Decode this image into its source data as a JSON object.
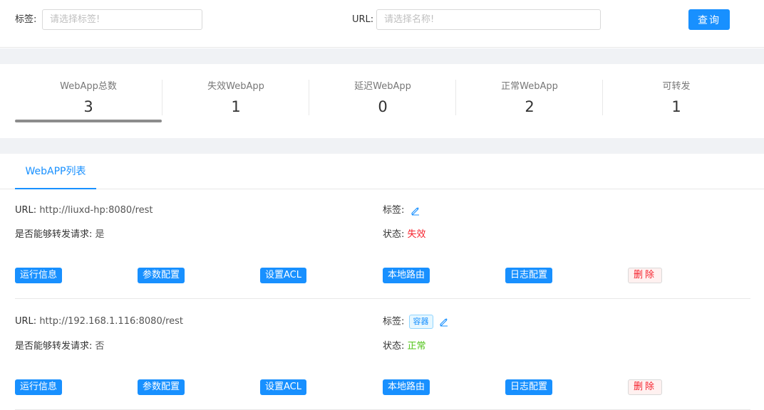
{
  "search": {
    "tag_label": "标签:",
    "tag_placeholder": "请选择标签!",
    "url_label": "URL:",
    "url_placeholder": "请选择名称!",
    "query_button": "查询"
  },
  "stats": [
    {
      "label": "WebApp总数",
      "value": "3"
    },
    {
      "label": "失效WebApp",
      "value": "1"
    },
    {
      "label": "延迟WebApp",
      "value": "0"
    },
    {
      "label": "正常WebApp",
      "value": "2"
    },
    {
      "label": "可转发",
      "value": "1"
    }
  ],
  "tabs": {
    "active": "WebAPP列表"
  },
  "webapps": [
    {
      "url_label": "URL:",
      "url": "http://liuxd-hp:8080/rest",
      "forward_label": "是否能够转发请求:",
      "forward": "是",
      "tag_label": "标签:",
      "tags": [],
      "status_label": "状态:",
      "status": "失效",
      "actions": [
        "运行信息",
        "参数配置",
        "设置ACL",
        "本地路由",
        "日志配置"
      ],
      "delete": "删除"
    },
    {
      "url_label": "URL:",
      "url": "http://192.168.1.116:8080/rest",
      "forward_label": "是否能够转发请求:",
      "forward": "否",
      "tag_label": "标签:",
      "tags": [
        "容器"
      ],
      "status_label": "状态:",
      "status": "正常",
      "actions": [
        "运行信息",
        "参数配置",
        "设置ACL",
        "本地路由",
        "日志配置"
      ],
      "delete": "删除"
    }
  ],
  "colors": {
    "primary": "#1890ff",
    "danger": "#f5222d",
    "success": "#52c41a"
  },
  "icons": {
    "edit": "edit-icon"
  }
}
